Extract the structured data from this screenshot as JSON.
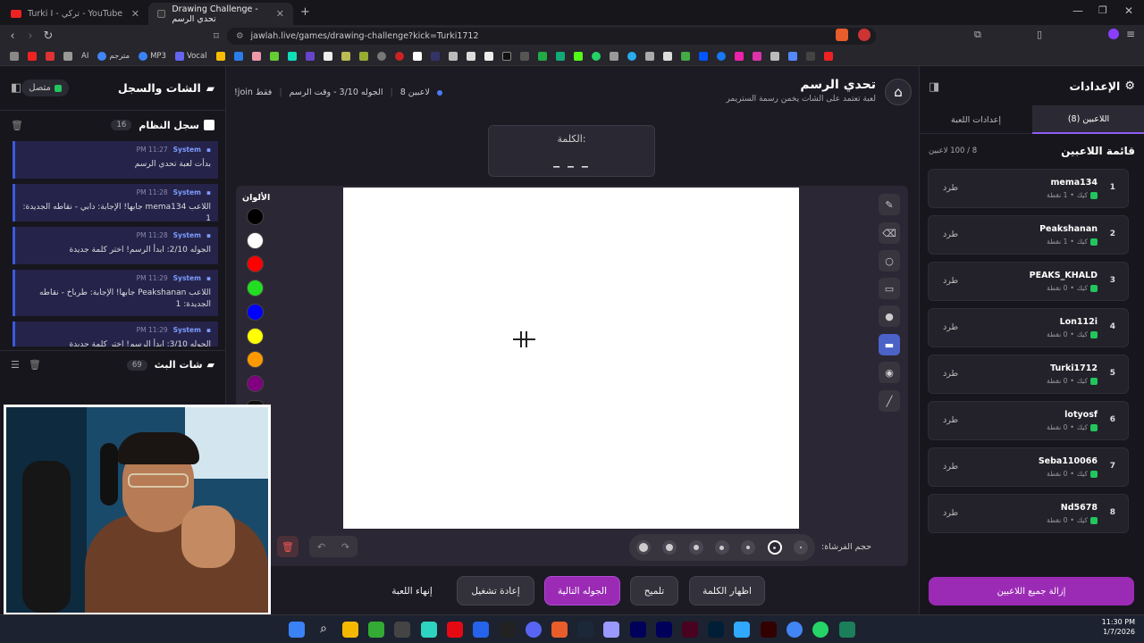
{
  "browser": {
    "tabs": [
      {
        "title": "Turki I - تركي - YouTube",
        "active": false
      },
      {
        "title": "Drawing Challenge - تحدي الرسم",
        "active": true
      }
    ],
    "new_tab": "+",
    "url": "jawlah.live/games/drawing-challenge?kick=Turki1712",
    "bookmarks": [
      "مترجم",
      "MP3",
      "Vocal",
      "AI"
    ]
  },
  "left_panel": {
    "title": "الشات والسجل",
    "status": "متصل",
    "system_log": {
      "title": "سجل النظام",
      "count": "16",
      "items": [
        {
          "source": "System",
          "time": "11:27 PM",
          "text": "بدأت لعبة تحدي الرسم"
        },
        {
          "source": "System",
          "time": "11:28 PM",
          "text": "اللاعب mema134 جابها! الإجابة: دابي - نقاطه الجديدة: 1"
        },
        {
          "source": "System",
          "time": "11:28 PM",
          "text": "الجوله 2/10: ابدأ الرسم! اختر كلمة جديدة"
        },
        {
          "source": "System",
          "time": "11:29 PM",
          "text": "اللاعب Peakshanan جابها! الإجابة: طرباخ - نقاطه الجديدة: 1"
        },
        {
          "source": "System",
          "time": "11:29 PM",
          "text": "الجوله 3/10: ابدأ الرسم! اختر كلمة جديدة"
        }
      ]
    },
    "stream_chat": {
      "title": "شات البث",
      "count": "69"
    }
  },
  "game": {
    "title": "تحدي الرسم",
    "subtitle": "لعبة تعتمد على الشات يخمن رسمة الستريمر",
    "players_count": "8 لاعبين",
    "round": "الجوله 3/10 - وقت الرسم",
    "join_hint": "!join فقط",
    "word_label": "الكلمة:",
    "word_mask": "_ _ _",
    "colors_label": "الألوان",
    "colors": [
      "#000000",
      "#ffffff",
      "#ff0000",
      "#22dd22",
      "#0000ff",
      "#ffff00",
      "#ff9900",
      "#800080"
    ],
    "brush_label": "حجم الفرشاة:",
    "brush_sizes_count": 7,
    "selected_brush_index": 5,
    "buttons": {
      "show_word": "اظهار الكلمة",
      "hint": "تلميح",
      "next_round": "الجوله التالية",
      "restart": "إعادة تشغيل",
      "end_game": "إنهاء اللعبة"
    }
  },
  "right_panel": {
    "title": "الإعدادات",
    "tabs": {
      "players": "اللاعبين (8)",
      "game_settings": "إعدادات اللعبة"
    },
    "list_title": "قائمة اللاعبين",
    "capacity": "8 / 100 لاعبين",
    "kick_label": "طرد",
    "players": [
      {
        "rank": "1",
        "name": "mema134",
        "points": "1 نقطة",
        "platform": "كيك"
      },
      {
        "rank": "2",
        "name": "Peakshanan",
        "points": "1 نقطة",
        "platform": "كيك"
      },
      {
        "rank": "3",
        "name": "PEAKS_KHALD",
        "points": "0 نقطة",
        "platform": "كيك"
      },
      {
        "rank": "4",
        "name": "Lon112i",
        "points": "0 نقطة",
        "platform": "كيك"
      },
      {
        "rank": "5",
        "name": "Turki1712",
        "points": "0 نقطة",
        "platform": "كيك"
      },
      {
        "rank": "6",
        "name": "lotyosf",
        "points": "0 نقطة",
        "platform": "كيك"
      },
      {
        "rank": "7",
        "name": "Seba110066",
        "points": "0 نقطة",
        "platform": "كيك"
      },
      {
        "rank": "8",
        "name": "Nd5678",
        "points": "0 نقطة",
        "platform": "كيك"
      }
    ],
    "remove_all": "إزالة جميع اللاعبين"
  },
  "taskbar": {
    "time": "11:30 PM",
    "date": "1/7/2026"
  },
  "accent": "#9b2bb5"
}
